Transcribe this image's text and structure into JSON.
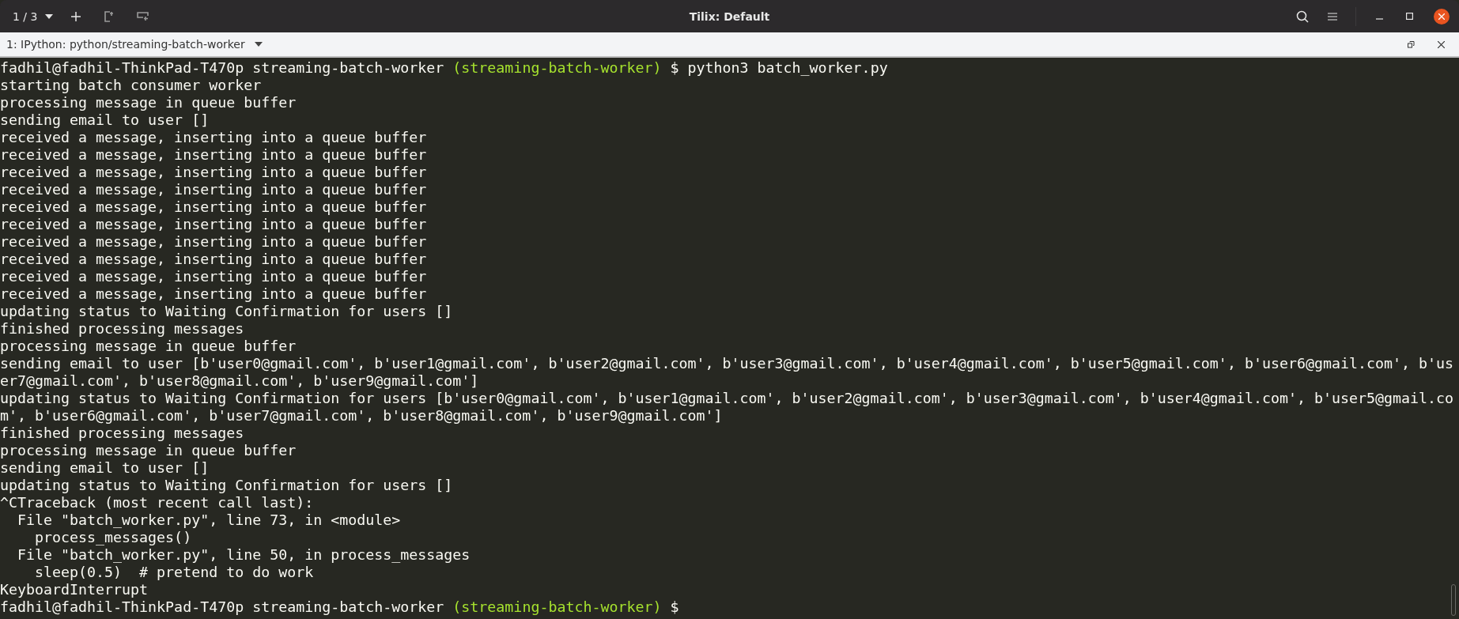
{
  "window": {
    "title": "Tilix: Default",
    "session_switcher": "1 / 3"
  },
  "session": {
    "title": "1: IPython: python/streaming-batch-worker"
  },
  "terminal": {
    "lines": [
      {
        "kind": "prompt",
        "path": "fadhil@fadhil-ThinkPad-T470p streaming-batch-worker",
        "branch": "(streaming-batch-worker)",
        "command": "$ python3 batch_worker.py"
      },
      {
        "kind": "output",
        "text": "starting batch consumer worker"
      },
      {
        "kind": "output",
        "text": "processing message in queue buffer"
      },
      {
        "kind": "output",
        "text": "sending email to user []"
      },
      {
        "kind": "output",
        "text": "received a message, inserting into a queue buffer"
      },
      {
        "kind": "output",
        "text": "received a message, inserting into a queue buffer"
      },
      {
        "kind": "output",
        "text": "received a message, inserting into a queue buffer"
      },
      {
        "kind": "output",
        "text": "received a message, inserting into a queue buffer"
      },
      {
        "kind": "output",
        "text": "received a message, inserting into a queue buffer"
      },
      {
        "kind": "output",
        "text": "received a message, inserting into a queue buffer"
      },
      {
        "kind": "output",
        "text": "received a message, inserting into a queue buffer"
      },
      {
        "kind": "output",
        "text": "received a message, inserting into a queue buffer"
      },
      {
        "kind": "output",
        "text": "received a message, inserting into a queue buffer"
      },
      {
        "kind": "output",
        "text": "received a message, inserting into a queue buffer"
      },
      {
        "kind": "output",
        "text": "updating status to Waiting Confirmation for users []"
      },
      {
        "kind": "output",
        "text": "finished processing messages"
      },
      {
        "kind": "output",
        "text": "processing message in queue buffer"
      },
      {
        "kind": "output",
        "text": "sending email to user [b'user0@gmail.com', b'user1@gmail.com', b'user2@gmail.com', b'user3@gmail.com', b'user4@gmail.com', b'user5@gmail.com', b'user6@gmail.com', b'us"
      },
      {
        "kind": "output",
        "text": "er7@gmail.com', b'user8@gmail.com', b'user9@gmail.com']"
      },
      {
        "kind": "output",
        "text": "updating status to Waiting Confirmation for users [b'user0@gmail.com', b'user1@gmail.com', b'user2@gmail.com', b'user3@gmail.com', b'user4@gmail.com', b'user5@gmail.co"
      },
      {
        "kind": "output",
        "text": "m', b'user6@gmail.com', b'user7@gmail.com', b'user8@gmail.com', b'user9@gmail.com']"
      },
      {
        "kind": "output",
        "text": "finished processing messages"
      },
      {
        "kind": "output",
        "text": "processing message in queue buffer"
      },
      {
        "kind": "output",
        "text": "sending email to user []"
      },
      {
        "kind": "output",
        "text": "updating status to Waiting Confirmation for users []"
      },
      {
        "kind": "output",
        "text": "^CTraceback (most recent call last):"
      },
      {
        "kind": "output",
        "text": "  File \"batch_worker.py\", line 73, in <module>"
      },
      {
        "kind": "output",
        "text": "    process_messages()"
      },
      {
        "kind": "output",
        "text": "  File \"batch_worker.py\", line 50, in process_messages"
      },
      {
        "kind": "output",
        "text": "    sleep(0.5)  # pretend to do work"
      },
      {
        "kind": "output",
        "text": "KeyboardInterrupt"
      },
      {
        "kind": "prompt",
        "path": "fadhil@fadhil-ThinkPad-T470p streaming-batch-worker",
        "branch": "(streaming-batch-worker)",
        "command": "$"
      }
    ]
  }
}
